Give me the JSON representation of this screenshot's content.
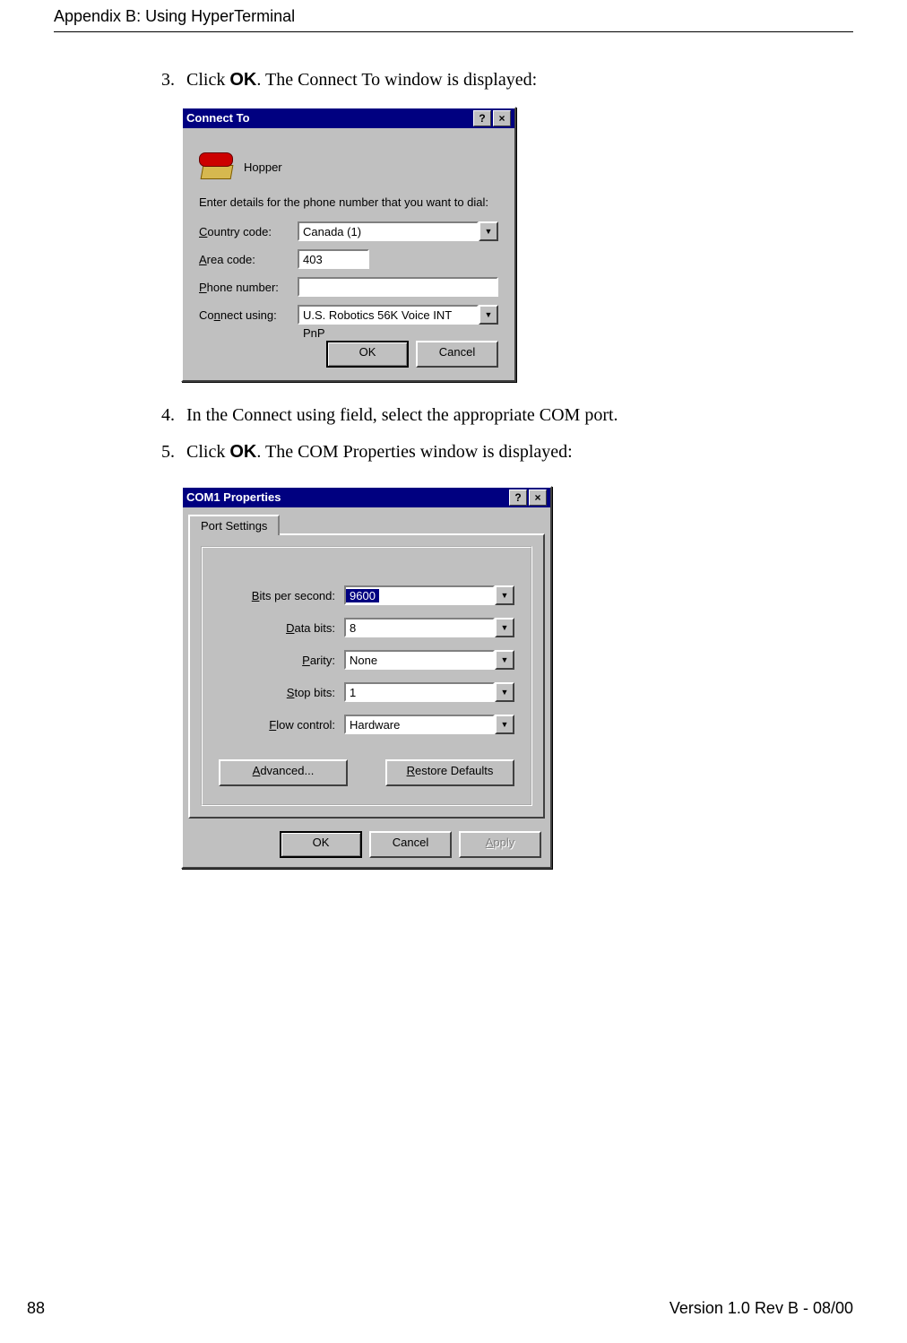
{
  "header": {
    "title": "Appendix B: Using HyperTerminal"
  },
  "steps": {
    "s3_num": "3.",
    "s3_a": "Click ",
    "s3_bold": "OK",
    "s3_b": ". The Connect To window is displayed:",
    "s4_num": "4.",
    "s4_text": "In the Connect using field, select the appropriate COM port.",
    "s5_num": "5.",
    "s5_a": "Click ",
    "s5_bold": "OK",
    "s5_b": ". The COM Properties window is displayed:"
  },
  "dlg1": {
    "title": "Connect To",
    "help": "?",
    "close": "×",
    "conn_name": "Hopper",
    "instr": "Enter details for the phone number that you want to dial:",
    "country_u": "C",
    "country_rest": "ountry code:",
    "country_val": "Canada (1)",
    "area_u": "A",
    "area_rest": "rea code:",
    "area_val": "403",
    "phone_u": "P",
    "phone_rest": "hone number:",
    "phone_val": "",
    "using_pre": "Co",
    "using_u": "n",
    "using_post": "nect using:",
    "using_val": "U.S. Robotics 56K Voice INT PnP",
    "ok": "OK",
    "cancel": "Cancel"
  },
  "dlg2": {
    "title": "COM1 Properties",
    "help": "?",
    "close": "×",
    "tab": "Port Settings",
    "bps_u": "B",
    "bps_rest": "its per second:",
    "bps_val": "9600",
    "data_u": "D",
    "data_rest": "ata bits:",
    "data_val": "8",
    "par_u": "P",
    "par_rest": "arity:",
    "par_val": "None",
    "stop_u": "S",
    "stop_rest": "top bits:",
    "stop_val": "1",
    "flow_u": "F",
    "flow_rest": "low control:",
    "flow_val": "Hardware",
    "adv_u": "A",
    "adv_rest": "dvanced...",
    "rest_u": "R",
    "rest_rest": "estore Defaults",
    "ok": "OK",
    "cancel": "Cancel",
    "apply_u": "A",
    "apply_rest": "pply"
  },
  "footer": {
    "page": "88",
    "version": "Version 1.0 Rev B - 08/00"
  },
  "dd_glyph": "▼"
}
